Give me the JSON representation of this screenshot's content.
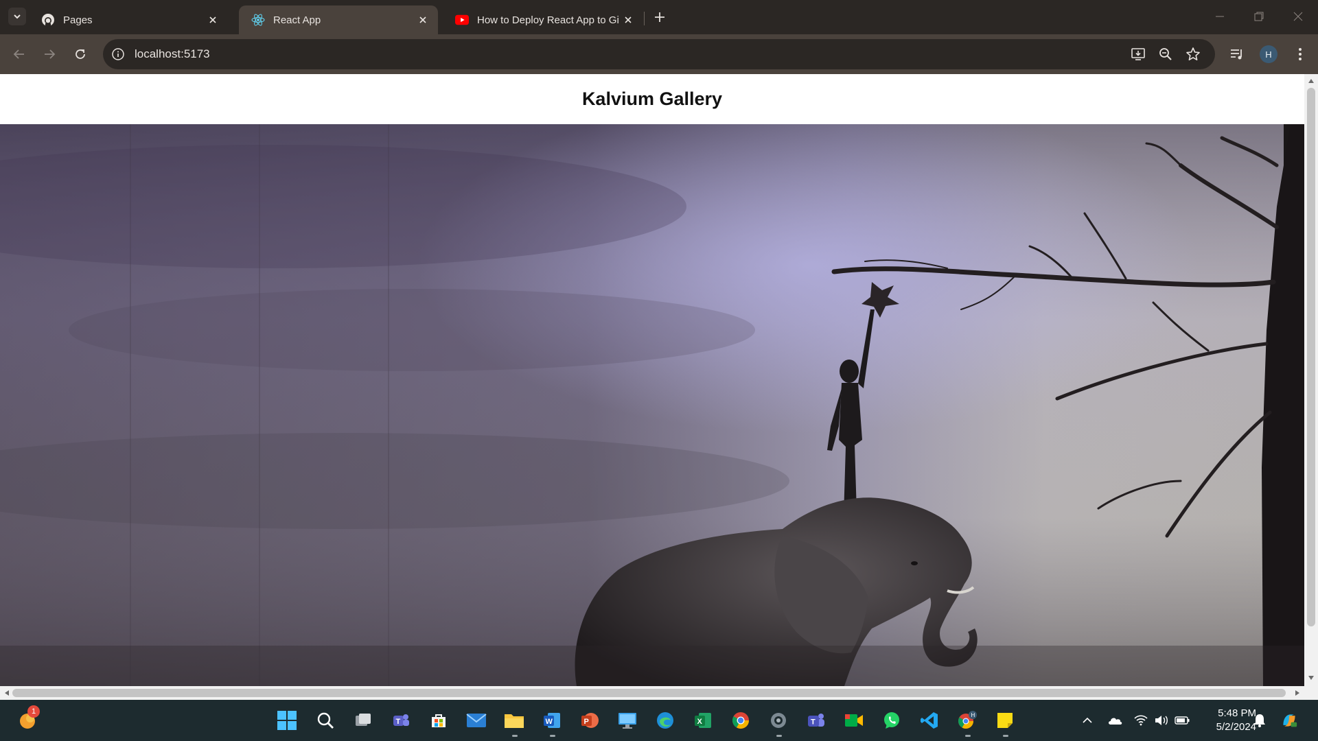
{
  "browser": {
    "tabs": [
      {
        "title": "Pages",
        "favicon": "github-icon",
        "active": false
      },
      {
        "title": "React App",
        "favicon": "react-icon",
        "active": true
      },
      {
        "title": "How to Deploy React App to Gi",
        "favicon": "youtube-icon",
        "active": false
      }
    ],
    "address": "localhost:5173",
    "profile_initial": "H"
  },
  "page": {
    "title": "Kalvium Gallery",
    "image": {
      "description_icon": "gallery-artwork-image"
    }
  },
  "taskbar": {
    "pinned": [
      "start-icon",
      "search-icon",
      "task-view-icon",
      "teams-icon",
      "store-icon",
      "mail-icon",
      "file-explorer-icon",
      "word-icon",
      "powerpoint-icon",
      "remote-desktop-icon",
      "edge-icon",
      "excel-icon",
      "chrome-icon",
      "settings-icon",
      "teams-work-icon",
      "meet-icon",
      "whatsapp-icon",
      "vscode-icon",
      "chrome-profile-icon",
      "sticky-notes-icon"
    ],
    "notification_count": "1",
    "time": "5:48 PM",
    "date": "5/2/2024"
  },
  "colors": {
    "accent": "#8ab4f8",
    "tab_active": "#4a423c",
    "taskbar": "#1d2b2f"
  }
}
